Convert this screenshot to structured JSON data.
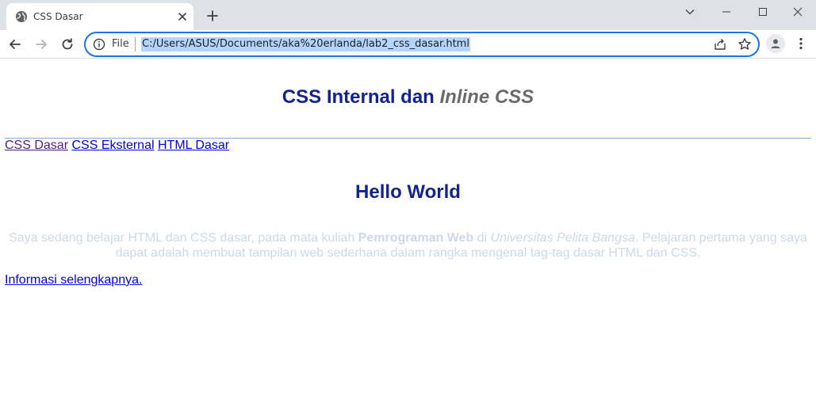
{
  "browser": {
    "tab": {
      "title": "CSS Dasar"
    },
    "address_bar": {
      "scheme_label": "File",
      "url": "C:/Users/ASUS/Documents/aka%20erlanda/lab2_css_dasar.html"
    },
    "accent_color": "#1a73e8"
  },
  "page": {
    "header": {
      "title_main": "CSS Internal dan ",
      "title_italic_1": "Inline",
      "title_space": " ",
      "title_italic_2": "CSS"
    },
    "nav": [
      {
        "label": "CSS Dasar",
        "state": "visited"
      },
      {
        "label": "CSS Eksternal",
        "state": "link"
      },
      {
        "label": "HTML Dasar",
        "state": "link"
      }
    ],
    "heading": "Hello World",
    "paragraph": {
      "part1": "Saya sedang belajar HTML dan CSS dasar, pada mata kuliah ",
      "bold": "Pemrograman Web",
      "part2": " di ",
      "italic": "Universitas Pelita Bangsa",
      "part3": ". Pelajaran pertama yang saya dapat adalah membuat tampilan web sederhana dalam rangka mengenal tag-tag dasar HTML dan CSS."
    },
    "more_link": "Informasi selengkapnya.",
    "colors": {
      "heading": "#12238f",
      "paragraph": "#ccd9e8",
      "link": "#0000ee",
      "visited_link": "#551a8b"
    }
  }
}
